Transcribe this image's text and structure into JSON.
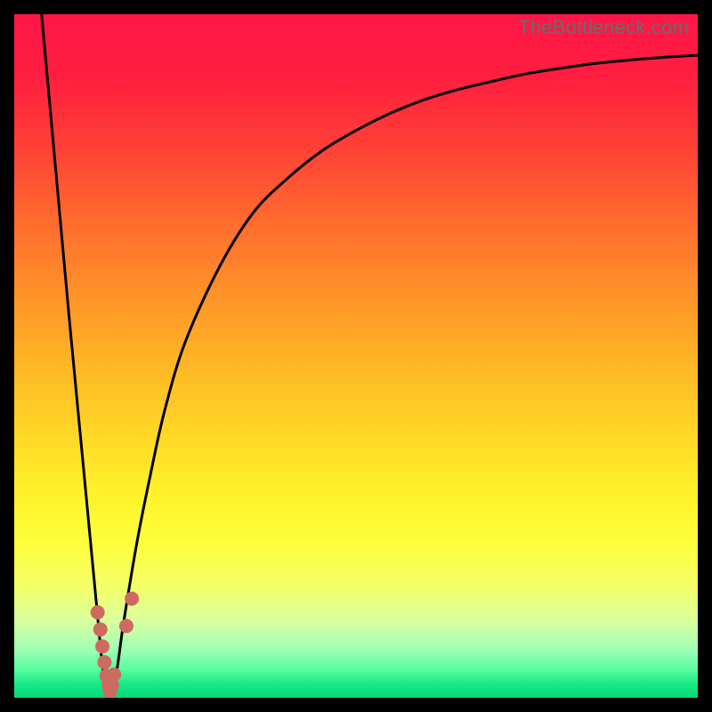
{
  "watermark": "TheBottleneck.com",
  "chart_data": {
    "type": "line",
    "title": "",
    "xlabel": "",
    "ylabel": "",
    "xlim": [
      0,
      100
    ],
    "ylim": [
      0,
      100
    ],
    "legend": false,
    "grid": false,
    "series": [
      {
        "name": "bottleneck-curve",
        "color": "#000000",
        "x": [
          4,
          6,
          8,
          10,
          12,
          13,
          14,
          15,
          16,
          18,
          20,
          22,
          25,
          30,
          35,
          40,
          45,
          50,
          55,
          60,
          65,
          70,
          75,
          80,
          85,
          90,
          95,
          100
        ],
        "y": [
          100,
          78,
          56,
          35,
          14,
          4,
          0,
          4,
          11,
          23,
          33,
          42,
          52,
          63,
          71,
          76,
          80,
          83,
          85.5,
          87.5,
          89,
          90.2,
          91.3,
          92.1,
          92.8,
          93.3,
          93.7,
          94
        ]
      }
    ],
    "markers": {
      "name": "highlight-points",
      "color": "#cf6a61",
      "points": [
        {
          "x": 12.2,
          "y": 12.5
        },
        {
          "x": 12.6,
          "y": 10.0
        },
        {
          "x": 12.9,
          "y": 7.5
        },
        {
          "x": 13.2,
          "y": 5.2
        },
        {
          "x": 13.5,
          "y": 3.2
        },
        {
          "x": 13.8,
          "y": 1.8
        },
        {
          "x": 14.0,
          "y": 0.9
        },
        {
          "x": 14.3,
          "y": 1.8
        },
        {
          "x": 14.6,
          "y": 3.4
        },
        {
          "x": 16.4,
          "y": 10.5
        },
        {
          "x": 17.2,
          "y": 14.5
        }
      ]
    }
  }
}
